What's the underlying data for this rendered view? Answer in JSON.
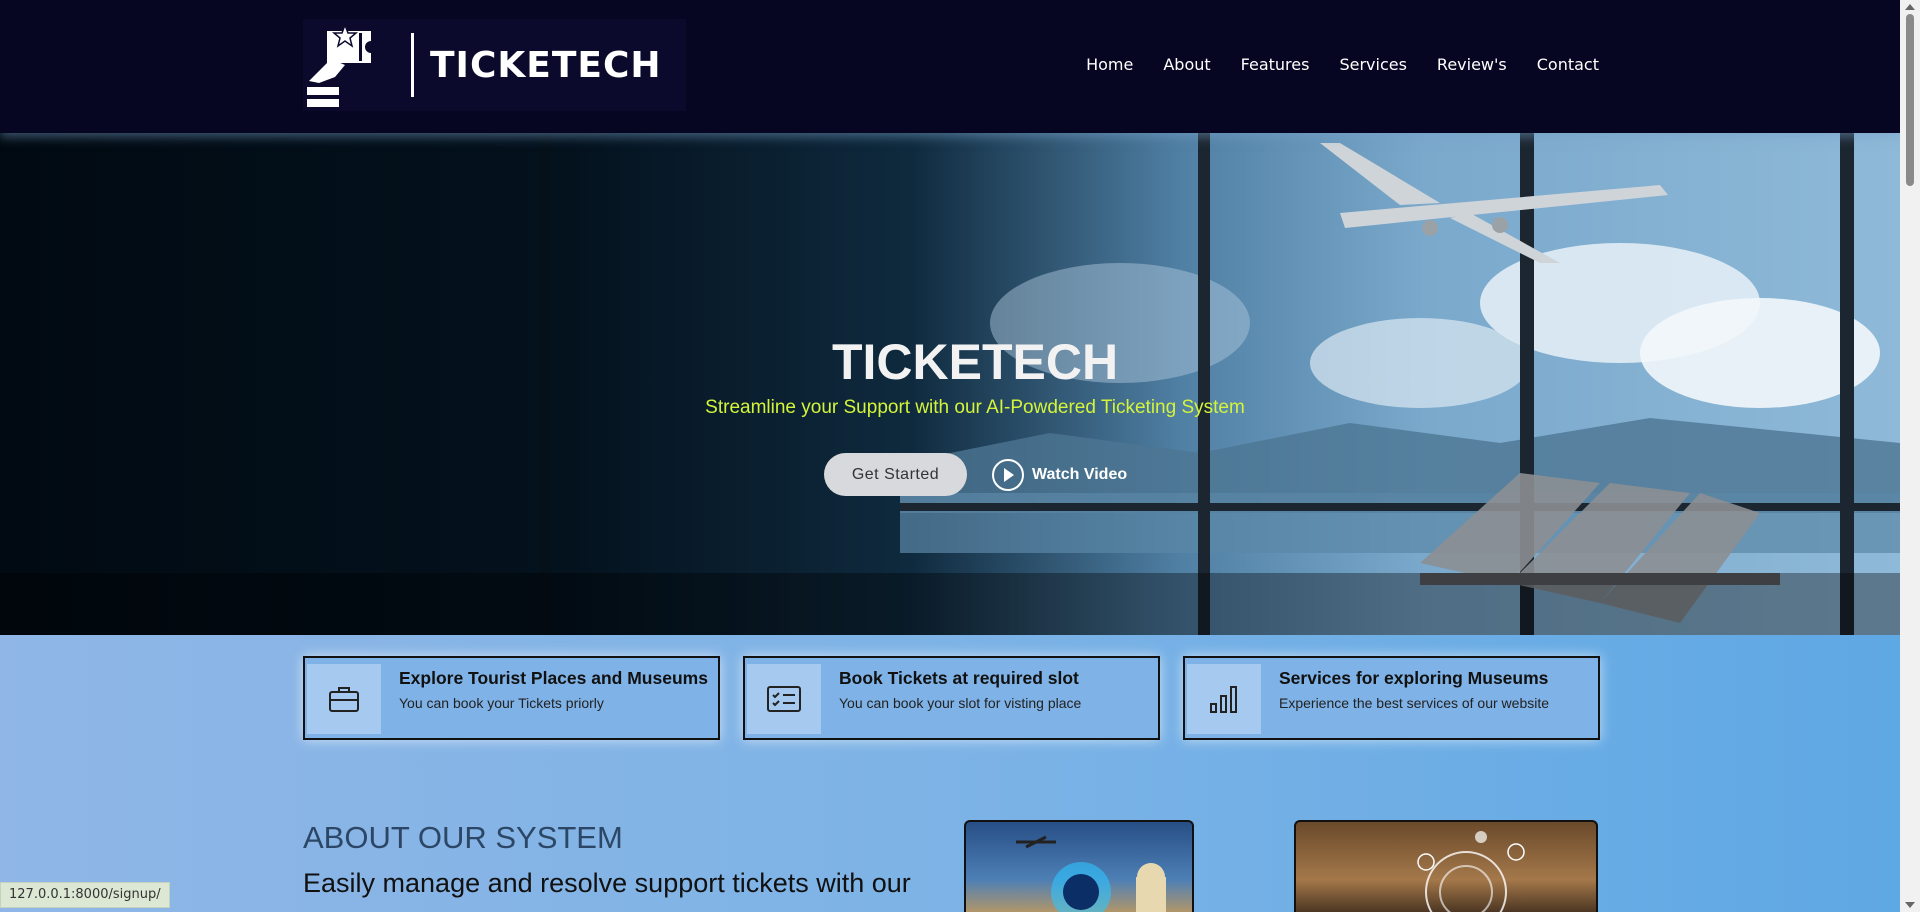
{
  "header": {
    "logo_text": "TICKETECH",
    "nav": [
      "Home",
      "About",
      "Features",
      "Services",
      "Review's",
      "Contact"
    ]
  },
  "hero": {
    "title": "TICKETECH",
    "subtitle": "Streamline your Support with our AI-Powdered Ticketing System",
    "get_started": "Get Started",
    "watch_video": "Watch Video"
  },
  "cards": [
    {
      "icon": "briefcase-icon",
      "title": "Explore Tourist Places and Museums",
      "desc": "You can book your Tickets priorly"
    },
    {
      "icon": "checklist-icon",
      "title": "Book Tickets at required slot",
      "desc": "You can book your slot for visting place"
    },
    {
      "icon": "bar-chart-icon",
      "title": "Services for exploring Museums",
      "desc": "Experience the best services of our website"
    }
  ],
  "about": {
    "heading": "ABOUT OUR SYSTEM",
    "text": "Easily manage and resolve support tickets with our"
  },
  "status_url": "127.0.0.1:8000/signup/",
  "colors": {
    "header_bg": "#060522",
    "subtitle": "#d4f43a",
    "section_bg": "#7fb0e6"
  }
}
